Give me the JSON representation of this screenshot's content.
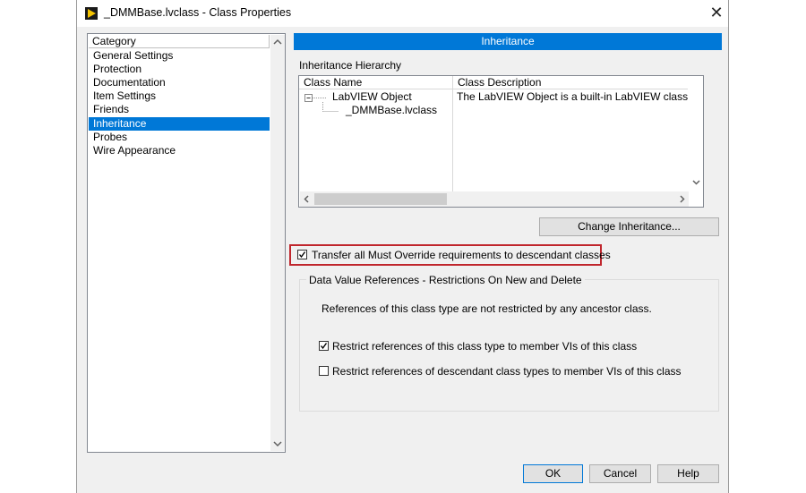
{
  "window": {
    "title": "_DMMBase.lvclass - Class Properties",
    "close_glyph": "✕"
  },
  "category": {
    "header": "Category",
    "items": [
      "General Settings",
      "Protection",
      "Documentation",
      "Item Settings",
      "Friends",
      "Inheritance",
      "Probes",
      "Wire Appearance"
    ],
    "selected": "Inheritance"
  },
  "inheritance": {
    "banner": "Inheritance",
    "hierarchy_label": "Inheritance Hierarchy",
    "columns": {
      "name": "Class Name",
      "description": "Class Description"
    },
    "rows": [
      {
        "name": "LabVIEW Object",
        "description": "The LabVIEW Object is a built-in LabVIEW class from w"
      },
      {
        "name": "_DMMBase.lvclass",
        "description": ""
      }
    ],
    "change_button": "Change Inheritance...",
    "transfer_checkbox": {
      "label": "Transfer all Must Override requirements to descendant classes",
      "checked": true
    }
  },
  "dvr": {
    "title": "Data Value References - Restrictions On New and Delete",
    "info": "References of this class type are not restricted by any ancestor class.",
    "restrict_member": {
      "label": "Restrict references of this class type to member VIs of this class",
      "checked": true
    },
    "restrict_descendant": {
      "label": "Restrict references of descendant class types to member VIs of this class",
      "checked": false
    }
  },
  "buttons": {
    "ok": "OK",
    "cancel": "Cancel",
    "help": "Help"
  },
  "colors": {
    "accent": "#0078d7",
    "highlight_border": "#c0262d"
  }
}
